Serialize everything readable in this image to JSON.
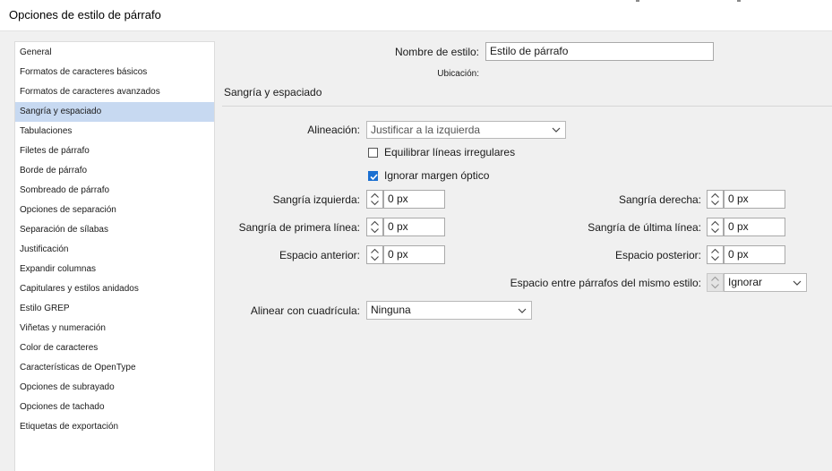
{
  "window": {
    "title": "Opciones de estilo de párrafo"
  },
  "sidebar": {
    "items": [
      {
        "label": "General"
      },
      {
        "label": "Formatos de caracteres básicos"
      },
      {
        "label": "Formatos de caracteres avanzados"
      },
      {
        "label": "Sangría y espaciado",
        "selected": true
      },
      {
        "label": "Tabulaciones"
      },
      {
        "label": "Filetes de párrafo"
      },
      {
        "label": "Borde de párrafo"
      },
      {
        "label": "Sombreado de párrafo"
      },
      {
        "label": "Opciones de separación"
      },
      {
        "label": "Separación de sílabas"
      },
      {
        "label": "Justificación"
      },
      {
        "label": "Expandir columnas"
      },
      {
        "label": "Capitulares y estilos anidados"
      },
      {
        "label": "Estilo GREP"
      },
      {
        "label": "Viñetas y numeración"
      },
      {
        "label": "Color de caracteres"
      },
      {
        "label": "Características de OpenType"
      },
      {
        "label": "Opciones de subrayado"
      },
      {
        "label": "Opciones de tachado"
      },
      {
        "label": "Etiquetas de exportación"
      }
    ]
  },
  "header": {
    "style_name_label": "Nombre de estilo:",
    "style_name_value": "Estilo de párrafo",
    "location_label": "Ubicación:"
  },
  "section": {
    "title": "Sangría y espaciado"
  },
  "alignment": {
    "label": "Alineación:",
    "value": "Justificar a la izquierda"
  },
  "checkboxes": {
    "balance": {
      "label": "Equilibrar líneas irregulares",
      "checked": false
    },
    "ignore_margin": {
      "label": "Ignorar margen óptico",
      "checked": true
    }
  },
  "fields": {
    "left_indent": {
      "label": "Sangría izquierda:",
      "value": "0 px"
    },
    "right_indent": {
      "label": "Sangría derecha:",
      "value": "0 px"
    },
    "first_line_indent": {
      "label": "Sangría de primera línea:",
      "value": "0 px"
    },
    "last_line_indent": {
      "label": "Sangría de última línea:",
      "value": "0 px"
    },
    "space_before": {
      "label": "Espacio anterior:",
      "value": "0 px"
    },
    "space_after": {
      "label": "Espacio posterior:",
      "value": "0 px"
    }
  },
  "same_style_spacing": {
    "label": "Espacio entre párrafos del mismo estilo:",
    "value": "Ignorar"
  },
  "grid_align": {
    "label": "Alinear con cuadrícula:",
    "value": "Ninguna"
  },
  "colors": {
    "selection": "#c7d9f1",
    "checkbox_accent": "#1a6fd1"
  }
}
